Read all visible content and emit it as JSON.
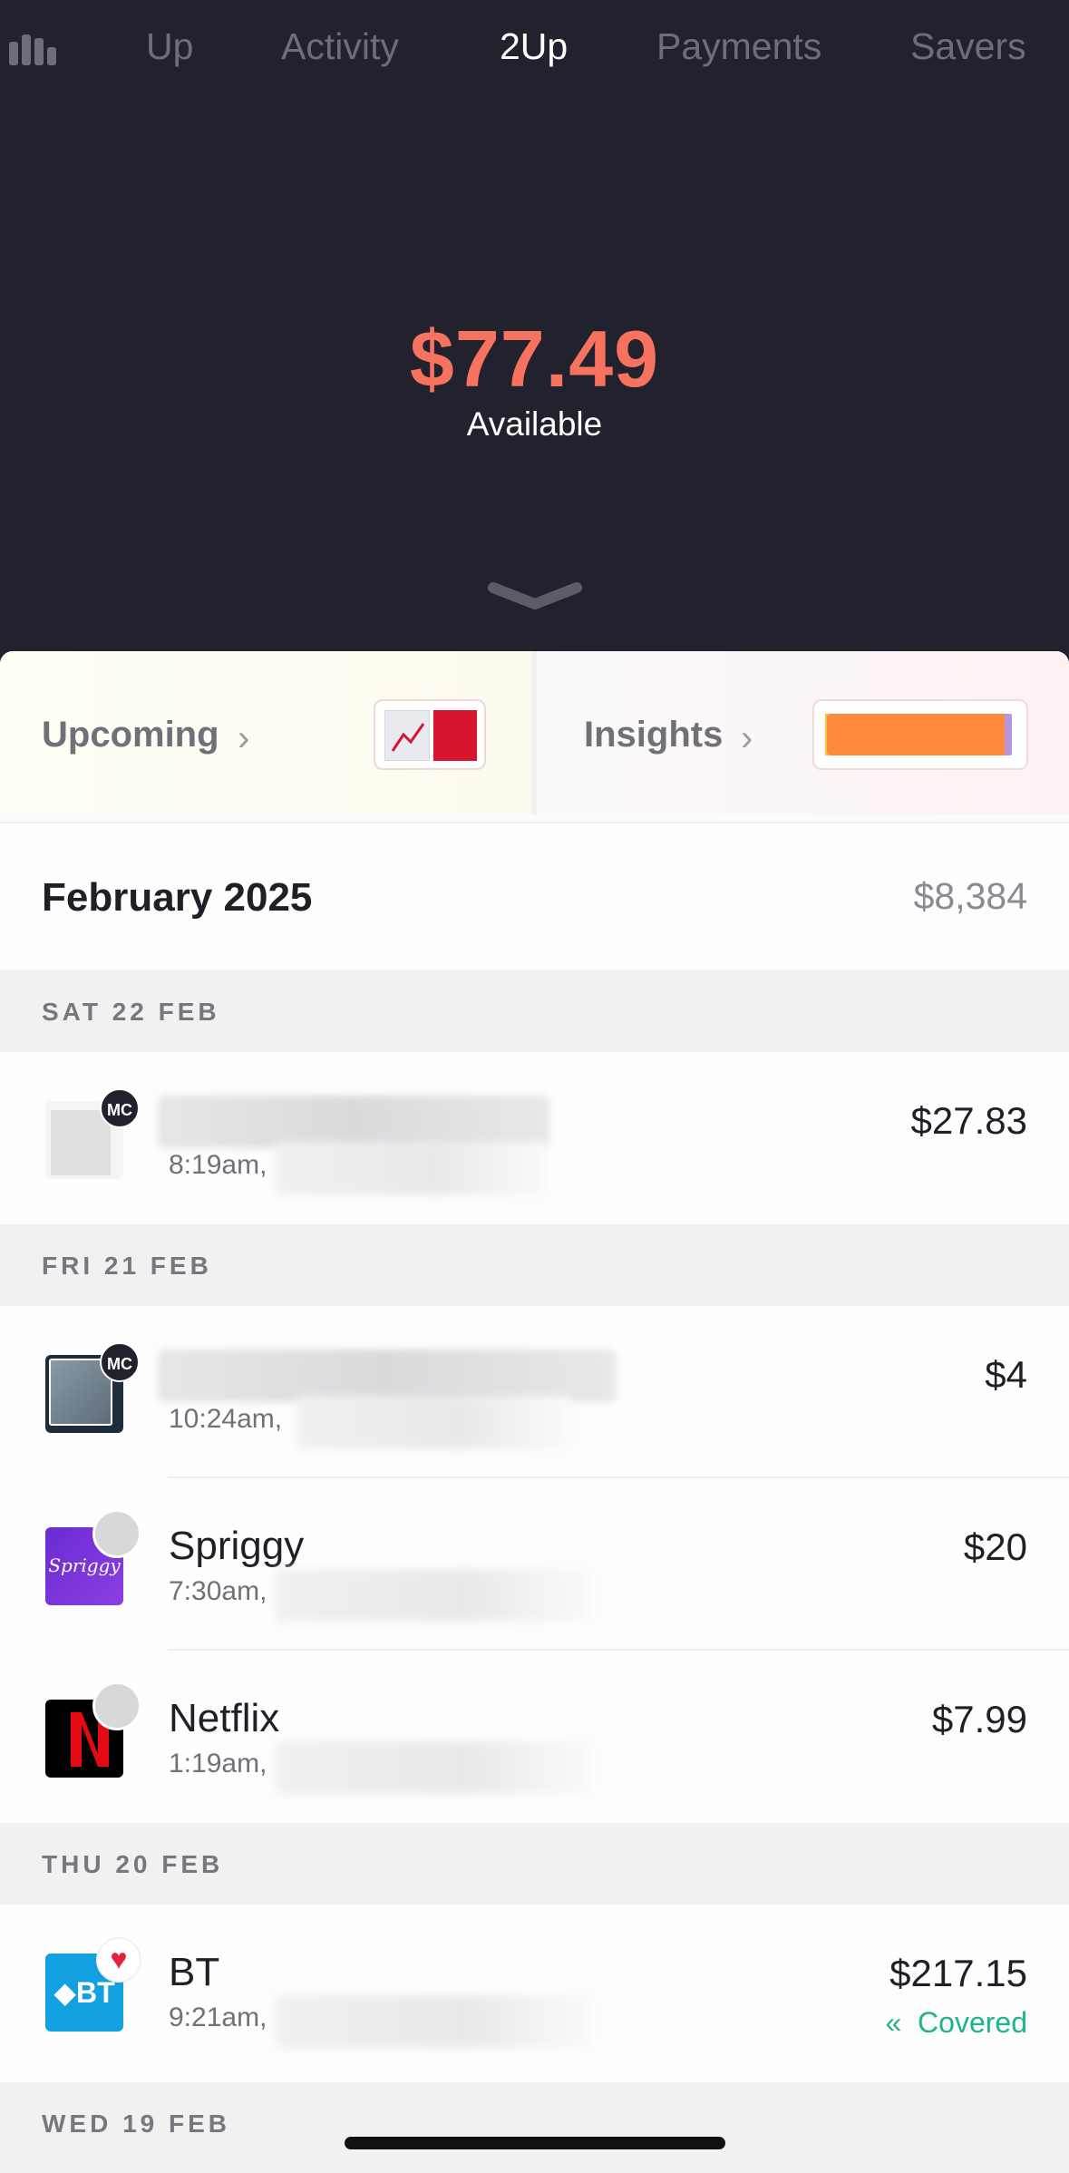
{
  "tabs": [
    "Up",
    "Activity",
    "2Up",
    "Payments",
    "Savers"
  ],
  "active_tab": "2Up",
  "balance": {
    "amount": "$77.49",
    "label": "Available"
  },
  "cards": {
    "upcoming": {
      "label": "Upcoming"
    },
    "insights": {
      "label": "Insights"
    }
  },
  "month": {
    "title": "February 2025",
    "total": "$8,384"
  },
  "days": [
    {
      "label": "SAT 22 FEB",
      "transactions": [
        {
          "merchant": "",
          "time": "8:19am,",
          "amount": "$27.83",
          "badge": "MC"
        }
      ]
    },
    {
      "label": "FRI 21 FEB",
      "transactions": [
        {
          "merchant": "",
          "time": "10:24am,",
          "amount": "$4",
          "badge": "MC"
        },
        {
          "merchant": "Spriggy",
          "time": "7:30am,",
          "amount": "$20"
        },
        {
          "merchant": "Netflix",
          "time": "1:19am,",
          "amount": "$7.99"
        }
      ]
    },
    {
      "label": "THU 20 FEB",
      "transactions": [
        {
          "merchant": "BT",
          "time": "9:21am,",
          "amount": "$217.15",
          "status": "Covered"
        }
      ]
    },
    {
      "label": "WED 19 FEB",
      "transactions": []
    }
  ],
  "colors": {
    "balance": "#f7725f",
    "dark_bg": "#22222e",
    "covered": "#1fb58a"
  }
}
